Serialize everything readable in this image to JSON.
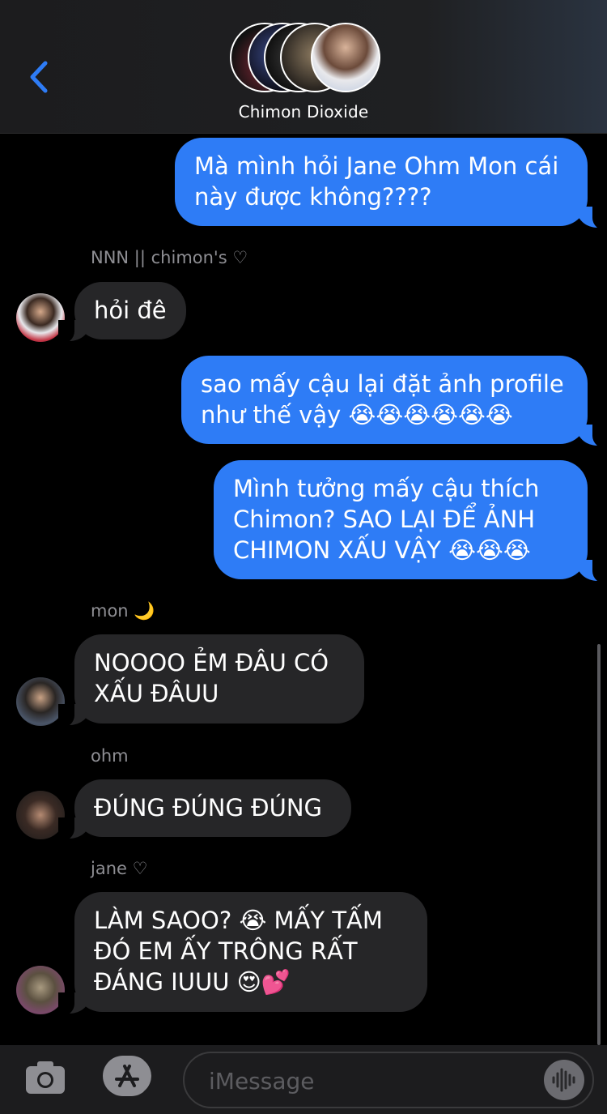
{
  "header": {
    "title": "Chimon Dioxide",
    "back_icon": "chevron-left-icon"
  },
  "messages": [
    {
      "direction": "outgoing",
      "text": "Mà mình hỏi Jane Ohm Mon cái này được không????"
    },
    {
      "direction": "incoming",
      "sender": "NNN || chimon's ♡",
      "text": "hỏi đê"
    },
    {
      "direction": "outgoing",
      "text": "sao mấy cậu lại đặt ảnh profile như thế vậy 😭😭😭😭😭😭"
    },
    {
      "direction": "outgoing",
      "text": "Mình tưởng mấy cậu thích Chimon? SAO LẠI ĐỂ ẢNH CHIMON XẤU VẬY 😭😭😭"
    },
    {
      "direction": "incoming",
      "sender": "mon 🌙",
      "text": "NOOOO ẺM ĐÂU CÓ XẤU ĐÂUU"
    },
    {
      "direction": "incoming",
      "sender": "ohm",
      "text": "ĐÚNG ĐÚNG ĐÚNG"
    },
    {
      "direction": "incoming",
      "sender": "jane ♡",
      "text": "LÀM SAOO? 😭 MẤY TẤM ĐÓ EM ẤY TRÔNG RẤT ĐÁNG IUUU 😍💕"
    }
  ],
  "input": {
    "placeholder": "iMessage",
    "camera_icon": "camera-icon",
    "apps_icon": "app-store-icon",
    "audio_icon": "audio-waveform-icon"
  },
  "colors": {
    "outgoing_bubble": "#2e7cf6",
    "incoming_bubble": "#262628",
    "accent": "#2e7cf6"
  }
}
